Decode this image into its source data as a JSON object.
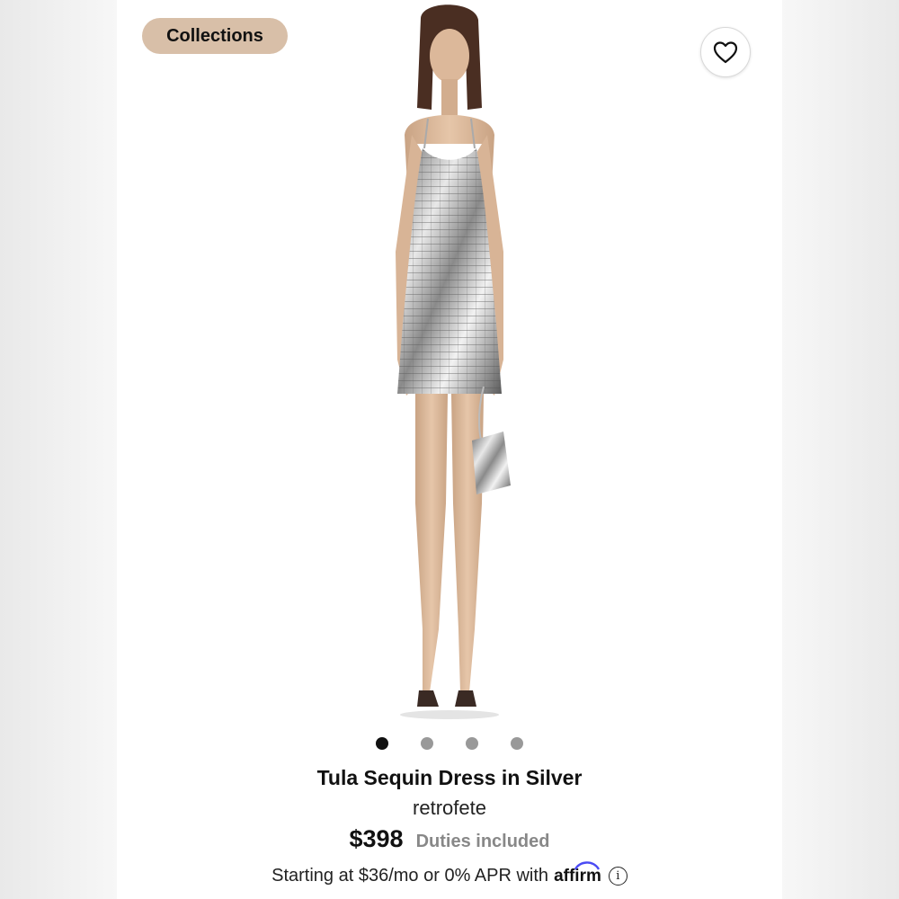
{
  "header": {
    "collections_label": "Collections"
  },
  "gallery": {
    "dot_count": 4,
    "active_index": 0
  },
  "product": {
    "title": "Tula Sequin Dress in Silver",
    "brand": "retrofete",
    "price": "$398",
    "duties": "Duties included"
  },
  "financing": {
    "text": "Starting at $36/mo or 0% APR with",
    "provider": "affirm",
    "info_icon": "i"
  },
  "colors": {
    "pill_bg": "#d8bfa8",
    "accent_affirm": "#4a4af4"
  }
}
